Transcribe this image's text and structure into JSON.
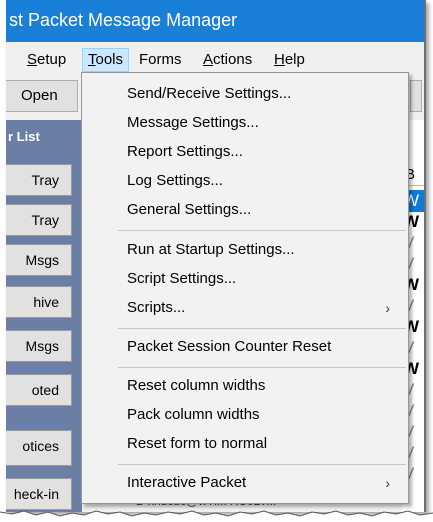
{
  "window": {
    "title": "st Packet Message Manager"
  },
  "menubar": [
    {
      "label": "Setup",
      "underline": "S",
      "rest": "etup"
    },
    {
      "label": "Tools",
      "underline": "T",
      "rest": "ools"
    },
    {
      "label": "Forms",
      "underline": "",
      "rest": "Forms"
    },
    {
      "label": "Actions",
      "underline": "A",
      "rest": "ctions"
    },
    {
      "label": "Help",
      "underline": "H",
      "rest": "elp"
    }
  ],
  "toolbar": {
    "open_label": "Open"
  },
  "sidebar": {
    "header": "r List",
    "buttons": [
      "Tray",
      "Tray",
      "Msgs",
      "hive",
      "Msgs",
      "oted",
      "otices",
      "heck-in"
    ]
  },
  "list": {
    "header": "B",
    "rows": [
      "W",
      "W",
      "V",
      "V",
      "W",
      "V",
      "W",
      "V",
      "W",
      "V",
      "V",
      "V",
      "V",
      "V"
    ]
  },
  "behind": {
    "text": "D     xhdcuc@wTl...    XC0LV..."
  },
  "tools_menu": {
    "items": [
      {
        "label": "Send/Receive Settings...",
        "submenu": false
      },
      {
        "label": "Message Settings...",
        "submenu": false
      },
      {
        "label": "Report Settings...",
        "submenu": false
      },
      {
        "label": "Log Settings...",
        "submenu": false
      },
      {
        "label": "General Settings...",
        "submenu": false
      },
      {
        "label": "Run at Startup Settings...",
        "submenu": false
      },
      {
        "label": "Script Settings...",
        "submenu": false
      },
      {
        "label": "Scripts...",
        "submenu": true
      },
      {
        "label": "Packet Session Counter Reset",
        "submenu": false
      },
      {
        "label": "Reset column widths",
        "submenu": false
      },
      {
        "label": "Pack column widths",
        "submenu": false
      },
      {
        "label": "Reset form to normal",
        "submenu": false
      },
      {
        "label": "Interactive Packet",
        "submenu": true
      }
    ],
    "submenu_arrow": "›"
  },
  "colors": {
    "titlebar": "#1a7fd6",
    "sidebar": "#6b7fa6",
    "selection": "#0f7ad8",
    "menu_highlight": "#cce8ff"
  }
}
